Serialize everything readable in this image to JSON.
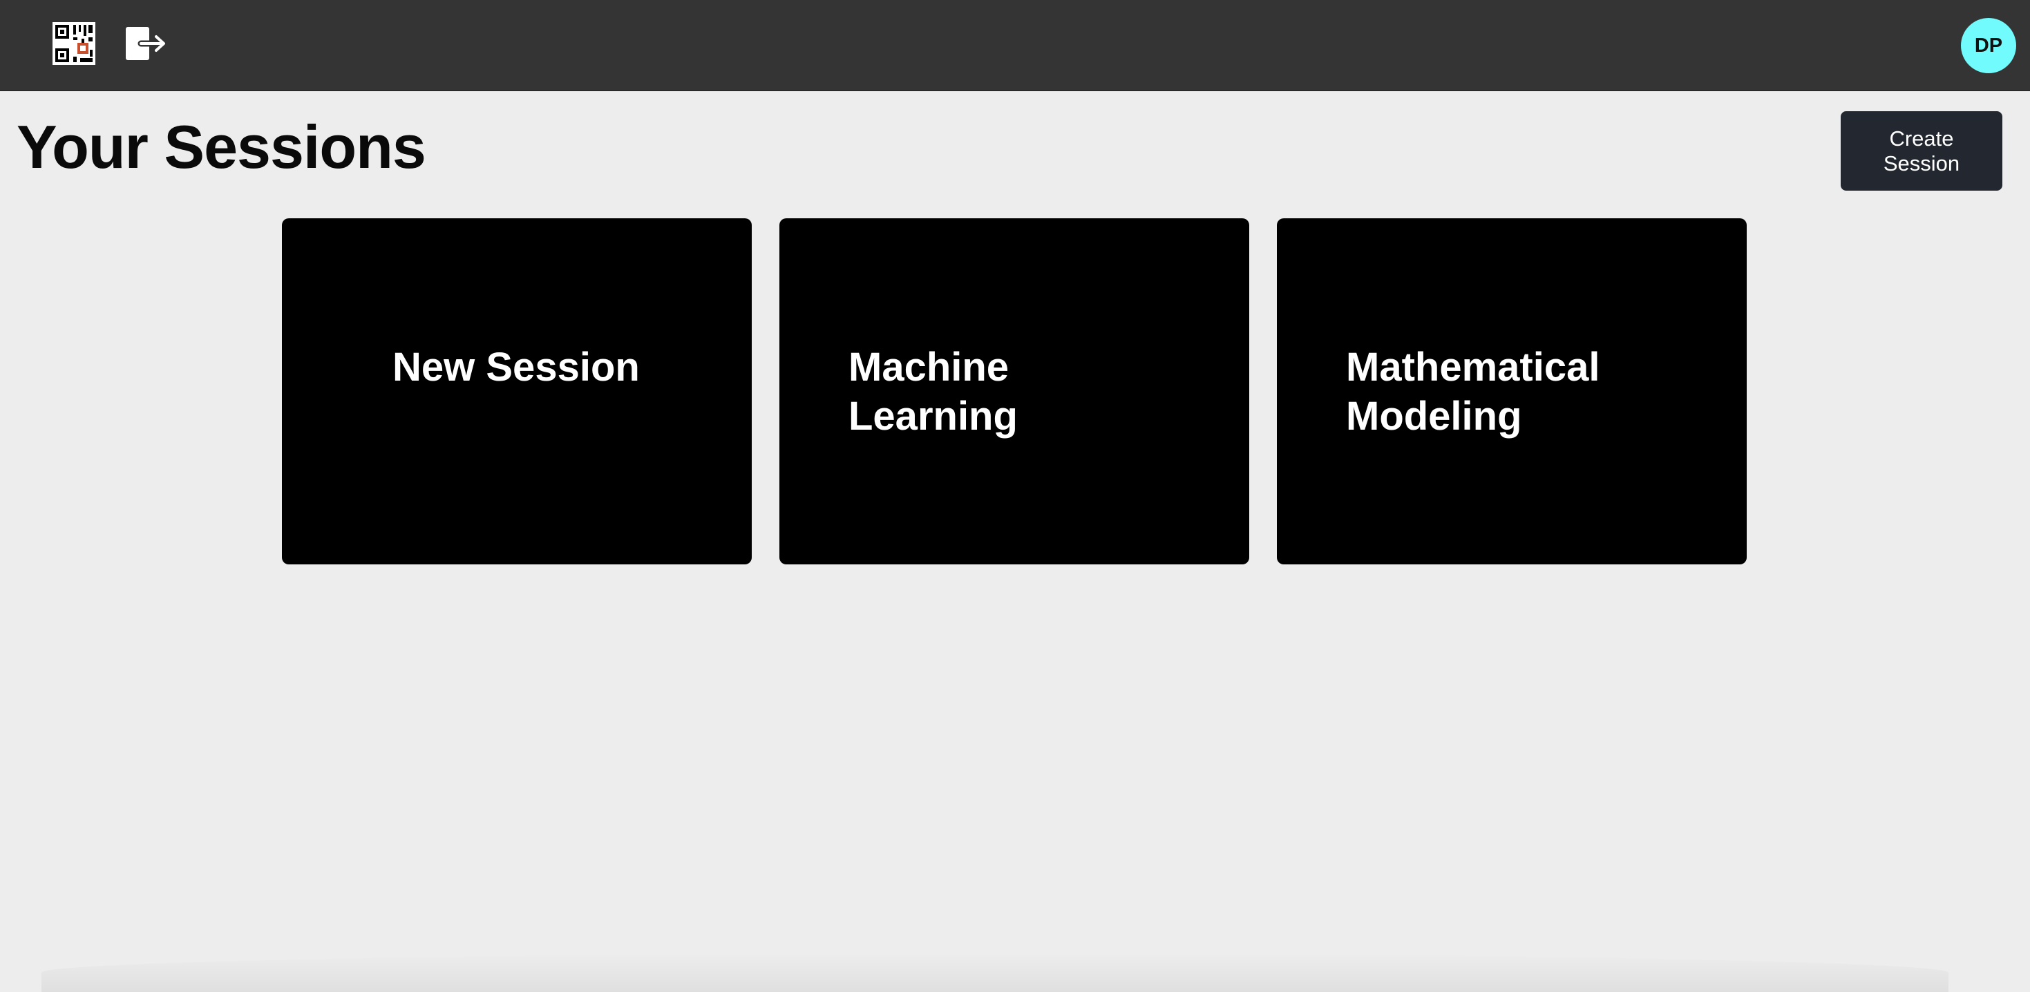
{
  "header": {
    "qr_icon": "qr-code-icon",
    "logout_icon": "logout-icon",
    "avatar_initials": "DP"
  },
  "main": {
    "title": "Your Sessions",
    "create_button_label": "Create Session",
    "sessions": [
      {
        "title": "New Session"
      },
      {
        "title": "Machine Learning"
      },
      {
        "title": "Mathematical Modeling"
      }
    ]
  },
  "colors": {
    "topbar": "#343434",
    "background": "#ededed",
    "avatar": "#72fbfd",
    "create_button": "#232730",
    "card": "#000000"
  }
}
